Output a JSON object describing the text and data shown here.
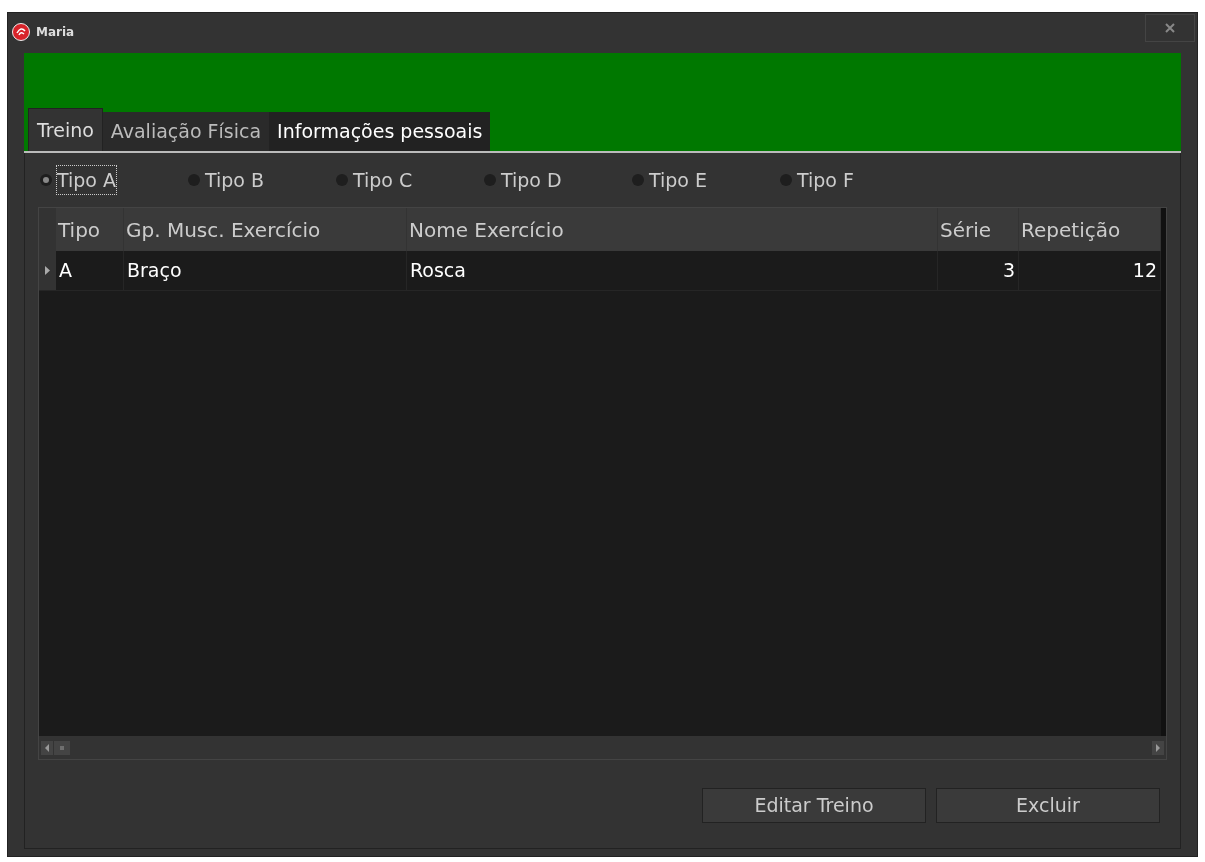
{
  "window": {
    "title": "Maria"
  },
  "tabs": [
    {
      "label": "Treino",
      "selected": true
    },
    {
      "label": "Avaliação Física",
      "selected": false
    },
    {
      "label": "Informações pessoais",
      "selected": false
    }
  ],
  "radios": [
    {
      "label": "Tipo A",
      "selected": true
    },
    {
      "label": "Tipo B",
      "selected": false
    },
    {
      "label": "Tipo C",
      "selected": false
    },
    {
      "label": "Tipo D",
      "selected": false
    },
    {
      "label": "Tipo E",
      "selected": false
    },
    {
      "label": "Tipo F",
      "selected": false
    }
  ],
  "table": {
    "columns": [
      {
        "label": "Tipo",
        "numeric": false
      },
      {
        "label": "Gp. Musc. Exercício",
        "numeric": false
      },
      {
        "label": "Nome Exercício",
        "numeric": false
      },
      {
        "label": "Série",
        "numeric": true
      },
      {
        "label": "Repetição",
        "numeric": true
      }
    ],
    "rows": [
      {
        "current": true,
        "cells": [
          "A",
          "Braço",
          "Rosca",
          "3",
          "12"
        ]
      }
    ]
  },
  "buttons": [
    "Editar Treino",
    "Excluir"
  ]
}
